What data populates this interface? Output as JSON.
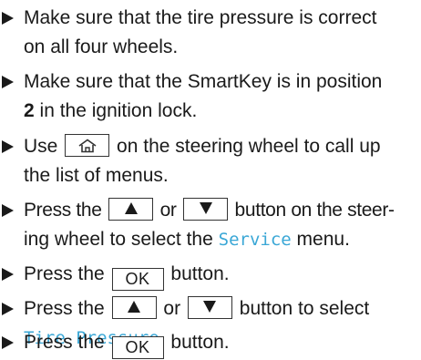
{
  "steps": [
    {
      "line1": "Make sure that the tire pressure is correct",
      "line2": "on all four wheels."
    },
    {
      "line1": "Make sure that the SmartKey is in position",
      "position_value": "2",
      "line2_rest": " in the ignition lock."
    },
    {
      "before": "Use",
      "key_icon": "home-icon",
      "after": "on the steering wheel to call up",
      "line2": "the list of menus."
    },
    {
      "before": "Press the",
      "key_up_icon": "up-triangle-icon",
      "or": "or",
      "key_down_icon": "down-triangle-icon",
      "after": "button on the steer-",
      "line2_before": "ing wheel to select the ",
      "menu_name": "Service",
      "line2_after": " menu."
    },
    {
      "before": "Press the",
      "key_label": "OK",
      "after": "button."
    },
    {
      "before": "Press the",
      "key_up_icon": "up-triangle-icon",
      "or": "or",
      "key_down_icon": "down-triangle-icon",
      "after": "button to select",
      "menu_name": "Tire Pressure",
      "line2_after": "."
    },
    {
      "before": "Press the",
      "key_label": "OK",
      "after": "button."
    }
  ],
  "colors": {
    "text": "#1a1a1a",
    "menu_highlight": "#3aa7d6",
    "key_border": "#333333"
  }
}
